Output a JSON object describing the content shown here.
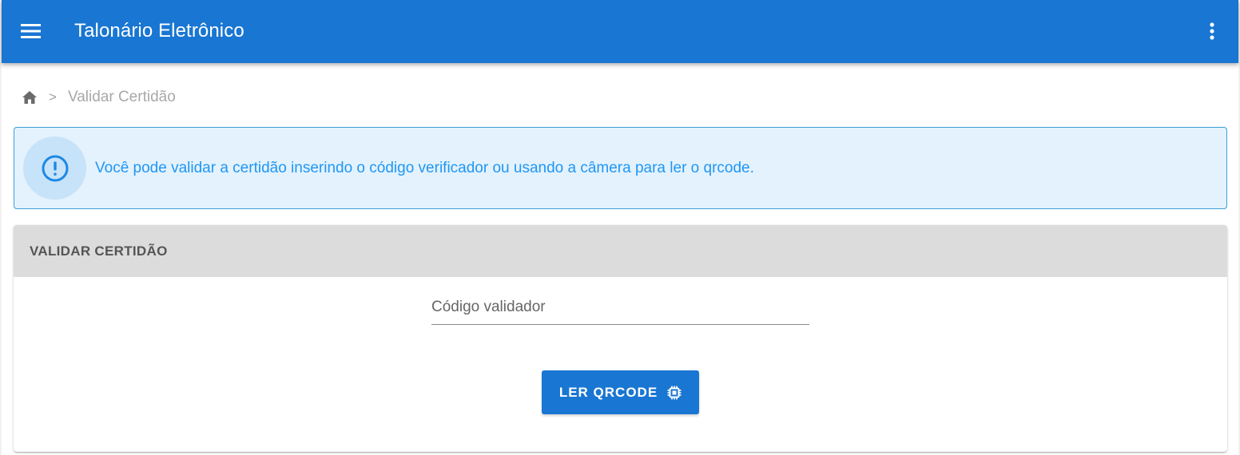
{
  "app": {
    "title": "Talonário Eletrônico",
    "menu_icon": "hamburger-menu-icon",
    "more_icon": "more-vertical-icon"
  },
  "breadcrumb": {
    "home_icon": "home-icon",
    "separator": ">",
    "current": "Validar Certidão"
  },
  "alert": {
    "icon": "exclamation-circle-icon",
    "message": "Você pode validar a certidão inserindo o código verificador ou usando a câmera para ler o qrcode."
  },
  "card": {
    "title": "VALIDAR CERTIDÃO",
    "code_field": {
      "placeholder": "Código validador",
      "value": ""
    },
    "qr_button": {
      "label": "LER QRCODE",
      "icon": "chip-icon"
    }
  },
  "colors": {
    "primary": "#1976d2",
    "alert_bg": "#e3f2fd",
    "alert_text": "#2196f3",
    "alert_border": "#3aa0d6",
    "card_header_bg": "#dcdcdc"
  }
}
